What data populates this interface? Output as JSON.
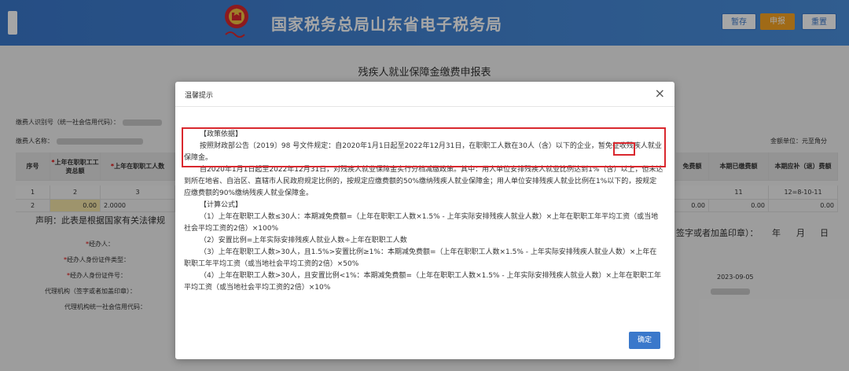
{
  "header": {
    "title": "国家税务总局山东省电子税务局",
    "buttons": {
      "save": "暂存",
      "report": "申报",
      "reset": "重置"
    }
  },
  "form": {
    "title": "残疾人就业保障金缴费申报表",
    "taxpayer_id_label": "缴费人识别号（统一社会信用代码）：",
    "taxpayer_name_label": "缴费人名称：",
    "amount_unit": "金额单位：元至角分",
    "columns_left": [
      "序号",
      "上年在职职工工资总额",
      "上年在职职工人数"
    ],
    "columns_right": [
      "免费额",
      "本期已缴费额",
      "本期应补（退）费额"
    ],
    "row_index": {
      "seq": "1",
      "wage": "2",
      "count": "3",
      "paid": "11",
      "formula": "12=8-10-11"
    },
    "row_data": {
      "seq": "2",
      "wage": "0.00",
      "count": "2.0000",
      "c1": "0.00",
      "c2": "0.00",
      "c3": "0.00"
    },
    "declaration": "声明：此表是根据国家有关法律规",
    "sign_text": "签字或者加盖印章）：",
    "date_labels": {
      "year": "年",
      "month": "月",
      "day": "日"
    },
    "fields": [
      {
        "label": "经办人："
      },
      {
        "label": "经办人身份证件类型："
      },
      {
        "label": "经办人身份证件号："
      },
      {
        "label": "代理机构（签字或者加盖印章）："
      },
      {
        "label": "代理机构统一社会信用代码："
      }
    ],
    "receive_date": "2023-09-05"
  },
  "modal": {
    "title": "温馨提示",
    "close": "×",
    "ok": "确定",
    "paragraphs": [
      "【政策依据】",
      "按照财政部公告〔2019〕98 号文件规定：自2020年1月1日起至2022年12月31日，在职职工人数在30人（含）以下的企业，暂免征收残疾人就业保障金。",
      "自2020年1月1日起至2022年12月31日，对残疾人就业保障金实行分档减缴政策。其中：用人单位安排残疾人就业比例达到1%（含）以上，但未达到所在地省、自治区、直辖市人民政府规定比例的，按规定应缴费额的50%缴纳残疾人就业保障金；用人单位安排残疾人就业比例在1%以下的，按规定应缴费额的90%缴纳残疾人就业保障金。",
      "【计算公式】",
      "（1）上年在职职工人数≤30人：本期减免费额=（上年在职职工人数×1.5% - 上年实际安排残疾人就业人数）×上年在职职工年平均工资（或当地社会平均工资的2倍）×100%",
      "（2）安置比例=上年实际安排残疾人就业人数÷上年在职职工人数",
      "（3）上年在职职工人数>30人，且1.5%>安置比例≥1%：本期减免费额=（上年在职职工人数×1.5% - 上年实际安排残疾人就业人数）×上年在职职工年平均工资（或当地社会平均工资的2倍）×50%",
      "（4）上年在职职工人数>30人，且安置比例<1%：本期减免费额=（上年在职职工人数×1.5% - 上年实际安排残疾人就业人数）×上年在职职工年平均工资（或当地社会平均工资的2倍）×10%"
    ]
  }
}
